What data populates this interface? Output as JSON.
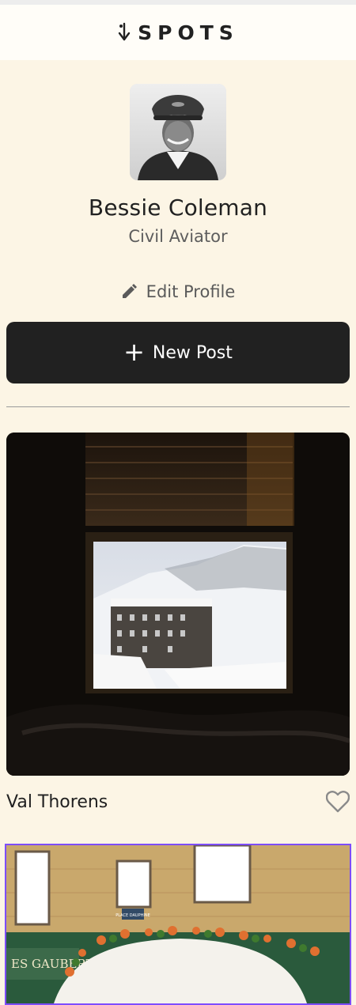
{
  "header": {
    "logo_text": "SPOTS"
  },
  "profile": {
    "name": "Bessie Coleman",
    "description": "Civil Aviator",
    "edit_label": "Edit Profile"
  },
  "actions": {
    "new_post_label": "New Post"
  },
  "cards": [
    {
      "title": "Val Thorens",
      "liked": false
    }
  ],
  "partial_card": {
    "sign_text": "ES GAUBERT",
    "plaque_text": "PLACE DAUPHINE"
  },
  "colors": {
    "background": "#fcf5e5",
    "dark": "#212121",
    "focus_outline": "#7d4dff"
  }
}
